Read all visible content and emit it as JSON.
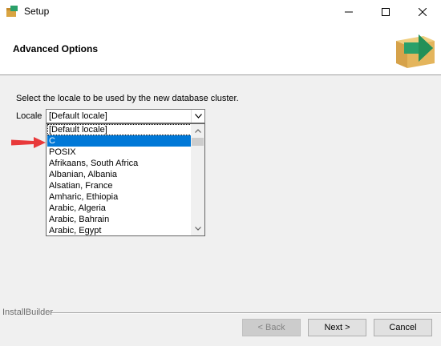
{
  "window": {
    "title": "Setup",
    "controls": {
      "minimize": "—",
      "maximize": "☐",
      "close": "✕"
    }
  },
  "header": {
    "title": "Advanced Options",
    "logo_icon": "installbuilder-box-arrow-icon"
  },
  "main": {
    "description": "Select the locale to be used by the new database cluster.",
    "locale_label": "Locale",
    "locale_value": "[Default locale]",
    "dropdown_items": [
      "[Default locale]",
      "C",
      "POSIX",
      "Afrikaans, South Africa",
      "Albanian, Albania",
      "Alsatian, France",
      "Amharic, Ethiopia",
      "Arabic, Algeria",
      "Arabic, Bahrain",
      "Arabic, Egypt"
    ],
    "selected_index": 1
  },
  "footer": {
    "brand": "InstallBuilder",
    "back": "< Back",
    "next": "Next >",
    "cancel": "Cancel"
  },
  "colors": {
    "selection": "#0078d7",
    "annotation_arrow": "#e8393a",
    "logo_box": "#e0b45a",
    "logo_arrow": "#2aa06a"
  }
}
